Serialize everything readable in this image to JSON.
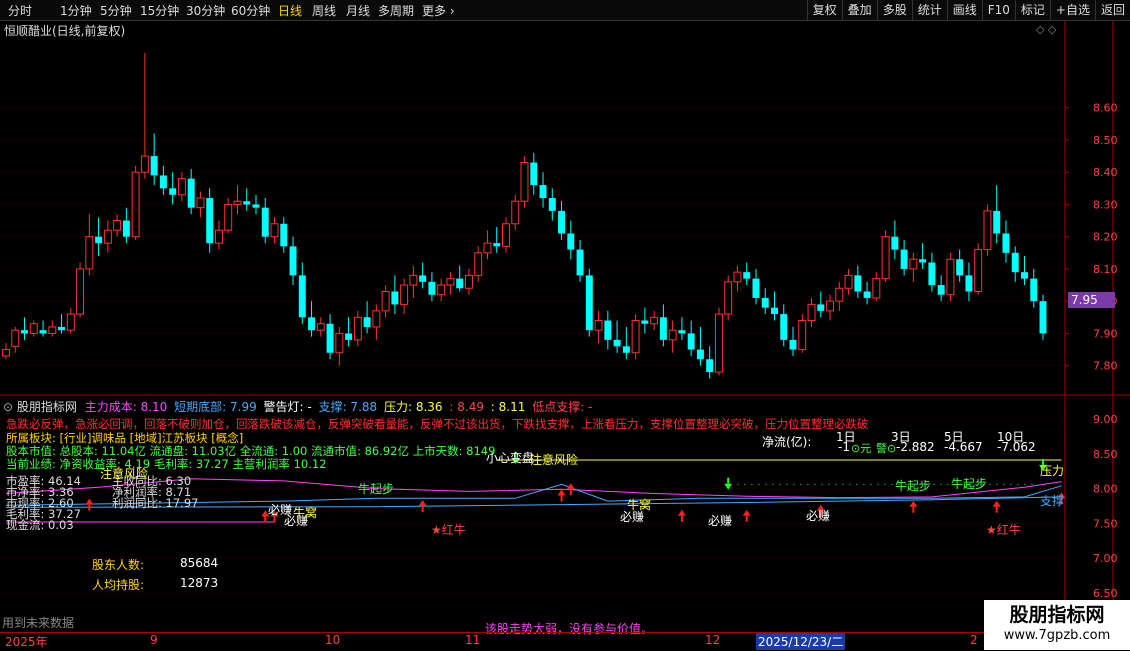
{
  "toolbar": {
    "periods": [
      "分时",
      "1分钟",
      "5分钟",
      "15分钟",
      "30分钟",
      "60分钟",
      "日线",
      "周线",
      "月线",
      "多周期",
      "更多"
    ],
    "active_period": "日线",
    "right_buttons": [
      "复权",
      "叠加",
      "多股",
      "统计",
      "画线",
      "F10",
      "标记",
      "+自选",
      "返回"
    ]
  },
  "main_panel": {
    "title": "恒顺醋业(日线,前复权)",
    "current_price_tag": "7.95",
    "status_note": "用到未来数据"
  },
  "indicator_panel": {
    "name": "股朋指标网",
    "legend": [
      {
        "text": "主力成本: 8.10",
        "color": "#ff44ff"
      },
      {
        "text": "短期底部: 7.99",
        "color": "#44aaff"
      },
      {
        "text": "警告灯: -",
        "color": "#ffffff"
      },
      {
        "text": "支撑: 7.88",
        "color": "#44aaff"
      },
      {
        "text": "压力: 8.36",
        "color": "#ffff44"
      },
      {
        "text": ": 8.49",
        "color": "#ff4444"
      },
      {
        "text": ": 8.11",
        "color": "#ffff44"
      },
      {
        "text": "低点支撑: -",
        "color": "#ff4444"
      }
    ],
    "warning_text": "急跌必反弹，急涨必回调，回落不破则加仓，回落跌破该减仓，反弹突破看量能，反弹不过该出货，下跌找支撑，上涨看压力，支撑位置整理必突破，压力位置整理必跌破",
    "sector_line": "所属板块: [行业]调味品 [地域]江苏板块 [概念]",
    "capital_line": "股本市值: 总股本: 11.04亿 流通盘: 11.03亿 全流通: 1.00 流通市值: 86.92亿 上市天数: 8149",
    "performance_line": "当前业绩: 净资收益率: 4.19 毛利率: 37.27 主营利润率 10.12",
    "fundamentals": [
      "市盈率: 46.14",
      "市净率: 3.36",
      "市现率: 2.60",
      "毛利率: 37.27",
      "现金流: 0.03"
    ],
    "ratios": [
      "主收同比: 6.30",
      "净利润率: 8.71",
      "利润同比: 17.97"
    ],
    "net_flow_label": "净流(亿):",
    "net_flow_headers": [
      "1日",
      "3日",
      "5日",
      "10日"
    ],
    "net_flow_values": [
      "-1",
      "-2.882",
      "-4.667",
      "-7.062"
    ],
    "flow_symbols": [
      "⊙元",
      "警⊙"
    ],
    "shareholders_label": "股东人数:",
    "shareholders_value": "85684",
    "per_capita_label": "人均持股:",
    "per_capita_value": "12873",
    "footer_note": "该股走势太弱，没有参与价值。",
    "annotations": [
      {
        "text": "注意风险",
        "color": "#ffff44"
      },
      {
        "text": "小心变盘",
        "color": "#ffffff"
      },
      {
        "text": "注意风险",
        "color": "#ffff44"
      },
      {
        "text": "压力",
        "color": "#ffff44"
      },
      {
        "text": "支撑",
        "color": "#44aaff"
      },
      {
        "text": "牛起步",
        "color": "#44ff44"
      },
      {
        "text": "牛起步",
        "color": "#44ff44"
      },
      {
        "text": "牛起步",
        "color": "#44ff44"
      },
      {
        "text": "必赚",
        "color": "#ffffff"
      },
      {
        "text": "必赚",
        "color": "#ffffff"
      },
      {
        "text": "必赚",
        "color": "#ffffff"
      },
      {
        "text": "必赚",
        "color": "#ffffff"
      },
      {
        "text": "必赚",
        "color": "#ffffff"
      },
      {
        "text": "牛窝",
        "color": "#ffff44"
      },
      {
        "text": "牛窝",
        "color": "#ffff44"
      },
      {
        "text": "红牛",
        "color": "#ff4444"
      },
      {
        "text": "红牛",
        "color": "#ff4444"
      }
    ]
  },
  "date_axis": {
    "labels": [
      "2025年",
      "9",
      "10",
      "11",
      "12",
      "2"
    ],
    "cursor_date": "2025/12/23/二"
  },
  "watermark": {
    "line1": "股朋指标网",
    "line2": "www.7gpzb.com"
  },
  "colors": {
    "up": "#ff3232",
    "down": "#00ffff",
    "background": "#000000",
    "grid": "#440000"
  },
  "chart_data": [
    {
      "type": "candlestick",
      "title": "恒顺醋业(日线,前复权)",
      "y_ticks": [
        7.8,
        7.9,
        8.0,
        8.1,
        8.2,
        8.3,
        8.4,
        8.5,
        8.6
      ],
      "ylim": [
        7.74,
        8.81
      ],
      "current_price": 7.95,
      "ohlc": [
        [
          7.83,
          7.87,
          7.82,
          7.85
        ],
        [
          7.86,
          7.92,
          7.84,
          7.91
        ],
        [
          7.91,
          7.95,
          7.88,
          7.9
        ],
        [
          7.9,
          7.94,
          7.89,
          7.93
        ],
        [
          7.91,
          7.94,
          7.89,
          7.9
        ],
        [
          7.9,
          7.94,
          7.89,
          7.92
        ],
        [
          7.92,
          7.96,
          7.9,
          7.91
        ],
        [
          7.91,
          7.98,
          7.9,
          7.96
        ],
        [
          7.96,
          8.12,
          7.95,
          8.1
        ],
        [
          8.1,
          8.27,
          8.08,
          8.2
        ],
        [
          8.2,
          8.26,
          8.14,
          8.18
        ],
        [
          8.18,
          8.25,
          8.15,
          8.22
        ],
        [
          8.22,
          8.27,
          8.2,
          8.25
        ],
        [
          8.25,
          8.29,
          8.18,
          8.2
        ],
        [
          8.2,
          8.42,
          8.19,
          8.4
        ],
        [
          8.4,
          8.77,
          8.38,
          8.45
        ],
        [
          8.45,
          8.52,
          8.36,
          8.39
        ],
        [
          8.39,
          8.42,
          8.33,
          8.35
        ],
        [
          8.35,
          8.4,
          8.3,
          8.33
        ],
        [
          8.33,
          8.4,
          8.31,
          8.38
        ],
        [
          8.38,
          8.41,
          8.27,
          8.29
        ],
        [
          8.29,
          8.34,
          8.26,
          8.32
        ],
        [
          8.32,
          8.35,
          8.15,
          8.18
        ],
        [
          8.18,
          8.25,
          8.16,
          8.22
        ],
        [
          8.22,
          8.32,
          8.21,
          8.3
        ],
        [
          8.3,
          8.36,
          8.27,
          8.31
        ],
        [
          8.31,
          8.35,
          8.28,
          8.3
        ],
        [
          8.3,
          8.33,
          8.27,
          8.29
        ],
        [
          8.29,
          8.32,
          8.18,
          8.2
        ],
        [
          8.2,
          8.26,
          8.18,
          8.24
        ],
        [
          8.24,
          8.26,
          8.15,
          8.17
        ],
        [
          8.17,
          8.2,
          8.05,
          8.08
        ],
        [
          8.08,
          8.12,
          7.93,
          7.95
        ],
        [
          7.95,
          8.0,
          7.89,
          7.91
        ],
        [
          7.91,
          7.95,
          7.89,
          7.93
        ],
        [
          7.93,
          7.96,
          7.82,
          7.84
        ],
        [
          7.84,
          7.92,
          7.8,
          7.9
        ],
        [
          7.9,
          7.95,
          7.86,
          7.88
        ],
        [
          7.88,
          7.97,
          7.86,
          7.95
        ],
        [
          7.95,
          8.0,
          7.9,
          7.92
        ],
        [
          7.92,
          7.99,
          7.88,
          7.97
        ],
        [
          7.97,
          8.05,
          7.95,
          8.03
        ],
        [
          8.03,
          8.08,
          7.96,
          7.99
        ],
        [
          7.99,
          8.07,
          7.96,
          8.05
        ],
        [
          8.05,
          8.11,
          8.01,
          8.08
        ],
        [
          8.08,
          8.12,
          8.04,
          8.06
        ],
        [
          8.06,
          8.09,
          8.0,
          8.02
        ],
        [
          8.02,
          8.07,
          8.0,
          8.05
        ],
        [
          8.05,
          8.09,
          8.02,
          8.07
        ],
        [
          8.07,
          8.11,
          8.03,
          8.04
        ],
        [
          8.04,
          8.1,
          8.02,
          8.08
        ],
        [
          8.08,
          8.17,
          8.06,
          8.15
        ],
        [
          8.15,
          8.22,
          8.13,
          8.18
        ],
        [
          8.18,
          8.23,
          8.15,
          8.17
        ],
        [
          8.17,
          8.26,
          8.15,
          8.24
        ],
        [
          8.24,
          8.33,
          8.22,
          8.31
        ],
        [
          8.31,
          8.45,
          8.29,
          8.43
        ],
        [
          8.43,
          8.46,
          8.33,
          8.36
        ],
        [
          8.36,
          8.4,
          8.29,
          8.32
        ],
        [
          8.32,
          8.35,
          8.25,
          8.28
        ],
        [
          8.28,
          8.31,
          8.19,
          8.21
        ],
        [
          8.21,
          8.25,
          8.13,
          8.16
        ],
        [
          8.16,
          8.19,
          8.06,
          8.08
        ],
        [
          8.08,
          8.1,
          7.89,
          7.91
        ],
        [
          7.91,
          7.97,
          7.87,
          7.94
        ],
        [
          7.94,
          7.97,
          7.85,
          7.88
        ],
        [
          7.88,
          7.94,
          7.84,
          7.86
        ],
        [
          7.86,
          7.92,
          7.82,
          7.84
        ],
        [
          7.84,
          7.96,
          7.82,
          7.94
        ],
        [
          7.94,
          7.98,
          7.9,
          7.93
        ],
        [
          7.93,
          7.97,
          7.91,
          7.95
        ],
        [
          7.95,
          7.99,
          7.86,
          7.88
        ],
        [
          7.88,
          7.94,
          7.84,
          7.91
        ],
        [
          7.91,
          7.95,
          7.88,
          7.9
        ],
        [
          7.9,
          7.94,
          7.83,
          7.85
        ],
        [
          7.85,
          7.92,
          7.8,
          7.82
        ],
        [
          7.82,
          7.86,
          7.76,
          7.78
        ],
        [
          7.78,
          7.98,
          7.77,
          7.96
        ],
        [
          7.96,
          8.08,
          7.94,
          8.06
        ],
        [
          8.06,
          8.11,
          8.03,
          8.09
        ],
        [
          8.09,
          8.12,
          8.05,
          8.07
        ],
        [
          8.07,
          8.1,
          7.99,
          8.01
        ],
        [
          8.01,
          8.04,
          7.96,
          7.98
        ],
        [
          7.98,
          8.03,
          7.94,
          7.96
        ],
        [
          7.96,
          7.99,
          7.86,
          7.88
        ],
        [
          7.88,
          7.92,
          7.83,
          7.85
        ],
        [
          7.85,
          7.96,
          7.84,
          7.94
        ],
        [
          7.94,
          8.01,
          7.92,
          7.99
        ],
        [
          7.99,
          8.03,
          7.95,
          7.97
        ],
        [
          7.97,
          8.02,
          7.94,
          8.0
        ],
        [
          8.0,
          8.06,
          7.97,
          8.04
        ],
        [
          8.04,
          8.1,
          8.02,
          8.08
        ],
        [
          8.08,
          8.11,
          8.01,
          8.03
        ],
        [
          8.03,
          8.06,
          7.99,
          8.01
        ],
        [
          8.01,
          8.09,
          8.0,
          8.07
        ],
        [
          8.07,
          8.22,
          8.06,
          8.2
        ],
        [
          8.2,
          8.25,
          8.13,
          8.16
        ],
        [
          8.16,
          8.19,
          8.08,
          8.1
        ],
        [
          8.1,
          8.15,
          8.06,
          8.13
        ],
        [
          8.13,
          8.18,
          8.1,
          8.12
        ],
        [
          8.12,
          8.15,
          8.03,
          8.05
        ],
        [
          8.05,
          8.08,
          8.0,
          8.02
        ],
        [
          8.02,
          8.15,
          8.0,
          8.13
        ],
        [
          8.13,
          8.16,
          8.06,
          8.08
        ],
        [
          8.08,
          8.12,
          8.0,
          8.03
        ],
        [
          8.03,
          8.18,
          8.02,
          8.16
        ],
        [
          8.16,
          8.3,
          8.14,
          8.28
        ],
        [
          8.28,
          8.36,
          8.18,
          8.21
        ],
        [
          8.21,
          8.25,
          8.12,
          8.15
        ],
        [
          8.15,
          8.17,
          8.06,
          8.09
        ],
        [
          8.09,
          8.14,
          8.05,
          8.07
        ],
        [
          8.07,
          8.1,
          7.98,
          8.0
        ],
        [
          8.0,
          8.02,
          7.88,
          7.9
        ]
      ]
    },
    {
      "type": "line",
      "title": "股朋指标网",
      "y_ticks": [
        6.5,
        7.0,
        7.5,
        8.0,
        8.5,
        9.0
      ],
      "ylim": [
        6.4,
        9.1
      ],
      "series": [
        {
          "name": "主力成本",
          "color": "#ff44ff",
          "x": [
            0,
            10,
            20,
            30,
            40,
            50,
            60,
            70,
            80,
            90,
            100,
            110,
            114
          ],
          "values": [
            7.93,
            8.02,
            8.14,
            8.11,
            8.0,
            7.96,
            7.99,
            7.93,
            7.89,
            7.87,
            7.88,
            8.02,
            8.1
          ]
        },
        {
          "name": "短期底部",
          "color": "#44aaff",
          "x": [
            0,
            20,
            30,
            40,
            55,
            60,
            65,
            75,
            90,
            100,
            110,
            114
          ],
          "values": [
            7.76,
            7.8,
            7.82,
            7.86,
            7.86,
            8.06,
            7.82,
            7.86,
            7.86,
            7.86,
            7.88,
            8.04
          ]
        },
        {
          "name": "支撑",
          "color": "#44aaff",
          "x": [
            0,
            40,
            60,
            80,
            100,
            114
          ],
          "values": [
            7.73,
            7.74,
            7.77,
            7.8,
            7.84,
            7.88
          ]
        },
        {
          "name": "压力",
          "color": "#ffff44",
          "x": [
            53,
            114
          ],
          "values": [
            8.41,
            8.41
          ]
        }
      ]
    }
  ]
}
